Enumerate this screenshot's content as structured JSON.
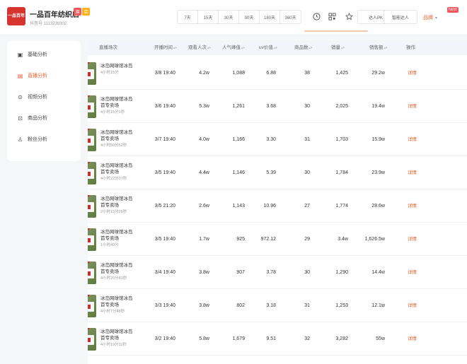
{
  "header": {
    "logo_text": "一品百年",
    "shop_name": "一品百年纺织店",
    "badge1": "旗",
    "badge2": "店",
    "shop_id": "抖音号 1113239302",
    "ranges": [
      "7天",
      "15天",
      "30天",
      "90天",
      "180天",
      "360天"
    ],
    "icons": [
      "clock-icon",
      "qrcode-icon",
      "star-icon"
    ],
    "compare_label": "达人PK",
    "ai_label": "智能达人",
    "user_label": "品牌",
    "notice_badge": "NEW"
  },
  "sidebar": {
    "items": [
      {
        "label": "基础分析",
        "icon": "▣",
        "active": false
      },
      {
        "label": "直播分析",
        "icon": "▤",
        "active": true
      },
      {
        "label": "视频分析",
        "icon": "⊙",
        "active": false
      },
      {
        "label": "商品分析",
        "icon": "⊡",
        "active": false
      },
      {
        "label": "粉丝分析",
        "icon": "♙",
        "active": false
      }
    ]
  },
  "table": {
    "columns": {
      "title": "直播场次",
      "start_time": "开播时间",
      "viewers": "观看人次",
      "popularity": "人气峰值",
      "uv": "uv价值",
      "products": "商品数",
      "sales": "销量",
      "revenue": "销售额",
      "action": "操作"
    },
    "rows": [
      {
        "title": "冰岛网球馆冰岛",
        "title2": "",
        "sub": "4小时15分",
        "start": "3/8 19:40",
        "viewers": "4.2w",
        "popularity": "1,088",
        "uv": "6.88",
        "products": "38",
        "sales": "1,425",
        "revenue": "29.2w",
        "action": "详情"
      },
      {
        "title": "冰岛网球馆冰岛",
        "title2": "首专卖场",
        "sub": "4小时15分1秒",
        "start": "3/6 19:40",
        "viewers": "5.3w",
        "popularity": "1,261",
        "uv": "3.68",
        "products": "30",
        "sales": "2,025",
        "revenue": "19.4w",
        "action": "详情"
      },
      {
        "title": "冰岛网球馆冰岛",
        "title2": "首专卖场",
        "sub": "4小时50分52秒",
        "start": "3/7 19:40",
        "viewers": "4.0w",
        "popularity": "1,166",
        "uv": "3.30",
        "products": "31",
        "sales": "1,703",
        "revenue": "15.9w",
        "action": "详情"
      },
      {
        "title": "冰岛网球馆冰岛",
        "title2": "首专卖场",
        "sub": "4小时22分37秒",
        "start": "3/5 19:40",
        "viewers": "4.4w",
        "popularity": "1,146",
        "uv": "5.39",
        "products": "30",
        "sales": "1,784",
        "revenue": "23.9w",
        "action": "详情"
      },
      {
        "title": "冰岛网球馆冰岛",
        "title2": "首专卖场",
        "sub": "2小时15分26秒",
        "start": "3/5 21:20",
        "viewers": "2.6w",
        "popularity": "1,143",
        "uv": "10.96",
        "products": "27",
        "sales": "1,774",
        "revenue": "28.6w",
        "action": "详情"
      },
      {
        "title": "冰岛网球馆冰岛",
        "title2": "首专卖场",
        "sub": "1小时40分",
        "start": "3/5 19:40",
        "viewers": "1.7w",
        "popularity": "925",
        "uv": "972.12",
        "products": "29",
        "sales": "3.4w",
        "revenue": "1,626.5w",
        "action": "详情"
      },
      {
        "title": "冰岛网球馆冰岛",
        "title2": "首专卖场",
        "sub": "4小时20分41秒",
        "start": "3/4 19:40",
        "viewers": "3.8w",
        "popularity": "907",
        "uv": "3.78",
        "products": "30",
        "sales": "1,290",
        "revenue": "14.4w",
        "action": "详情"
      },
      {
        "title": "冰岛网球馆冰岛",
        "title2": "首专卖场",
        "sub": "4小时7分48秒",
        "start": "3/3 19:40",
        "viewers": "3.8w",
        "popularity": "802",
        "uv": "3.18",
        "products": "31",
        "sales": "1,253",
        "revenue": "12.1w",
        "action": "详情"
      },
      {
        "title": "冰岛网球馆冰岛",
        "title2": "首专卖场",
        "sub": "4小时19分11秒",
        "start": "3/2 19:40",
        "viewers": "5.8w",
        "popularity": "1,679",
        "uv": "9.51",
        "products": "32",
        "sales": "3,282",
        "revenue": "55w",
        "action": "详情"
      }
    ]
  },
  "colors": {
    "accent": "#e8622c",
    "logo_red": "#d8342f",
    "header_bg": "#f3f5fa"
  }
}
